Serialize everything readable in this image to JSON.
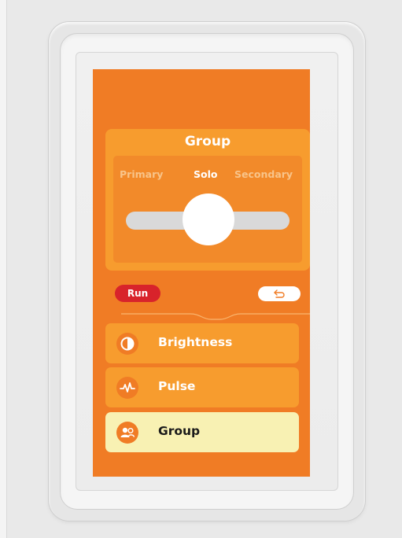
{
  "card": {
    "title": "Group",
    "modes": [
      "Primary",
      "Solo",
      "Secondary"
    ],
    "selected_mode": "Solo"
  },
  "controls": {
    "run_label": "Run",
    "back_icon": "undo-arrow-icon"
  },
  "list": {
    "items": [
      {
        "label": "Brightness",
        "icon": "half-circle-icon",
        "active": false
      },
      {
        "label": "Pulse",
        "icon": "pulse-wave-icon",
        "active": false
      },
      {
        "label": "Group",
        "icon": "group-users-icon",
        "active": true
      }
    ]
  },
  "colors": {
    "screen_bg": "#f07c25",
    "card_bg": "#f79c2e",
    "run_button": "#d8232b",
    "active_item": "#f8f1b3"
  }
}
